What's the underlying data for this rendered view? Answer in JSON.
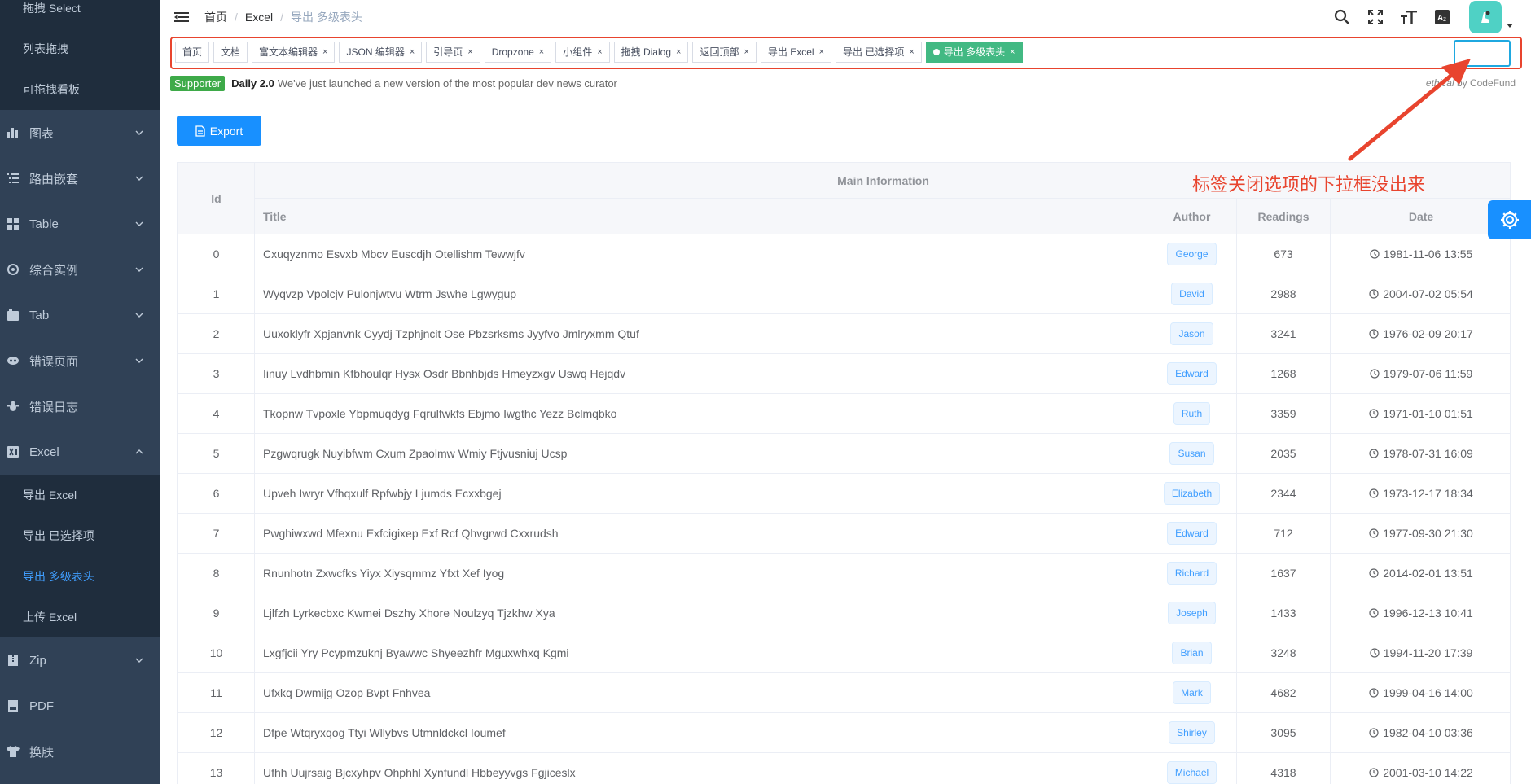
{
  "sidebar": {
    "top_items": [
      {
        "label": "拖拽 Select"
      },
      {
        "label": "列表拖拽"
      },
      {
        "label": "可拖拽看板"
      }
    ],
    "menu": [
      {
        "label": "图表",
        "icon": "chart-icon"
      },
      {
        "label": "路由嵌套",
        "icon": "nested-icon"
      },
      {
        "label": "Table",
        "icon": "table-icon"
      },
      {
        "label": "综合实例",
        "icon": "example-icon"
      },
      {
        "label": "Tab",
        "icon": "tab-icon"
      },
      {
        "label": "错误页面",
        "icon": "error-page-icon"
      },
      {
        "label": "错误日志",
        "icon": "bug-icon"
      },
      {
        "label": "Excel",
        "icon": "excel-icon"
      }
    ],
    "excel_sub": [
      {
        "label": "导出 Excel"
      },
      {
        "label": "导出 已选择项"
      },
      {
        "label": "导出 多级表头"
      },
      {
        "label": "上传 Excel"
      }
    ],
    "bottom_menu": [
      {
        "label": "Zip",
        "icon": "zip-icon"
      },
      {
        "label": "PDF",
        "icon": "pdf-icon"
      },
      {
        "label": "换肤",
        "icon": "shirt-icon"
      }
    ]
  },
  "breadcrumb": [
    "首页",
    "Excel",
    "导出 多级表头"
  ],
  "tags": [
    {
      "label": "首页",
      "closable": false
    },
    {
      "label": "文档",
      "closable": false
    },
    {
      "label": "富文本编辑器",
      "closable": true
    },
    {
      "label": "JSON 编辑器",
      "closable": true
    },
    {
      "label": "引导页",
      "closable": true
    },
    {
      "label": "Dropzone",
      "closable": true
    },
    {
      "label": "小组件",
      "closable": true
    },
    {
      "label": "拖拽 Dialog",
      "closable": true
    },
    {
      "label": "返回顶部",
      "closable": true
    },
    {
      "label": "导出 Excel",
      "closable": true
    },
    {
      "label": "导出 已选择项",
      "closable": true
    },
    {
      "label": "导出 多级表头",
      "closable": true,
      "active": true
    }
  ],
  "tag_close_glyph": "×",
  "sponsor": {
    "badge": "Supporter",
    "bold": "Daily 2.0",
    "text": "We've just launched a new version of the most popular dev news curator",
    "credit_italic": "ethical",
    "credit_rest": " by CodeFund"
  },
  "export_label": "Export",
  "table": {
    "group_header": "Main Information",
    "headers": {
      "id": "Id",
      "title": "Title",
      "author": "Author",
      "readings": "Readings",
      "date": "Date"
    },
    "rows": [
      {
        "id": "0",
        "title": "Cxuqyznmo Esvxb Mbcv Euscdjh Otellishm Tewwjfv",
        "author": "George",
        "readings": "673",
        "date": "1981-11-06 13:55"
      },
      {
        "id": "1",
        "title": "Wyqvzp Vpolcjv Pulonjwtvu Wtrm Jswhe Lgwygup",
        "author": "David",
        "readings": "2988",
        "date": "2004-07-02 05:54"
      },
      {
        "id": "2",
        "title": "Uuxoklyfr Xpjanvnk Cyydj Tzphjncit Ose Pbzsrksms Jyyfvo Jmlryxmm Qtuf",
        "author": "Jason",
        "readings": "3241",
        "date": "1976-02-09 20:17"
      },
      {
        "id": "3",
        "title": "Iinuy Lvdhbmin Kfbhoulqr Hysx Osdr Bbnhbjds Hmeyzxgv Uswq Hejqdv",
        "author": "Edward",
        "readings": "1268",
        "date": "1979-07-06 11:59"
      },
      {
        "id": "4",
        "title": "Tkopnw Tvpoxle Ybpmuqdyg Fqrulfwkfs Ebjmo Iwgthc Yezz Bclmqbko",
        "author": "Ruth",
        "readings": "3359",
        "date": "1971-01-10 01:51"
      },
      {
        "id": "5",
        "title": "Pzgwqrugk Nuyibfwm Cxum Zpaolmw Wmiy Ftjvusniuj Ucsp",
        "author": "Susan",
        "readings": "2035",
        "date": "1978-07-31 16:09"
      },
      {
        "id": "6",
        "title": "Upveh Iwryr Vfhqxulf Rpfwbjy Ljumds Ecxxbgej",
        "author": "Elizabeth",
        "readings": "2344",
        "date": "1973-12-17 18:34"
      },
      {
        "id": "7",
        "title": "Pwghiwxwd Mfexnu Exfcigixep Exf Rcf Qhvgrwd Cxxrudsh",
        "author": "Edward",
        "readings": "712",
        "date": "1977-09-30 21:30"
      },
      {
        "id": "8",
        "title": "Rnunhotn Zxwcfks Yiyx Xiysqmmz Yfxt Xef Iyog",
        "author": "Richard",
        "readings": "1637",
        "date": "2014-02-01 13:51"
      },
      {
        "id": "9",
        "title": "Ljlfzh Lyrkecbxc Kwmei Dszhy Xhore Noulzyq Tjzkhw Xya",
        "author": "Joseph",
        "readings": "1433",
        "date": "1996-12-13 10:41"
      },
      {
        "id": "10",
        "title": "Lxgfjcii Yry Pcypmzuknj Byawwc Shyeezhfr Mguxwhxq Kgmi",
        "author": "Brian",
        "readings": "3248",
        "date": "1994-11-20 17:39"
      },
      {
        "id": "11",
        "title": "Ufxkq Dwmijg Ozop Bvpt Fnhvea",
        "author": "Mark",
        "readings": "4682",
        "date": "1999-04-16 14:00"
      },
      {
        "id": "12",
        "title": "Dfpe Wtqryxqog Ttyi Wllybvs Utmnldckcl Ioumef",
        "author": "Shirley",
        "readings": "3095",
        "date": "1982-04-10 03:36"
      },
      {
        "id": "13",
        "title": "Ufhh Uujrsaig Bjcxyhpv Ohphhl Xynfundl Hbbeyyvgs Fgjiceslx",
        "author": "Michael",
        "readings": "4318",
        "date": "2001-03-10 14:22"
      }
    ]
  },
  "annotation": "标签关闭选项的下拉框没出来",
  "colors": {
    "sidebar_bg": "#304156",
    "sidebar_sub_bg": "#1f2d3d",
    "active_link": "#409eff",
    "active_tag": "#42b983",
    "primary": "#1890ff",
    "annotation_red": "#e8442e",
    "highlight_cyan": "#1fa8e0"
  }
}
